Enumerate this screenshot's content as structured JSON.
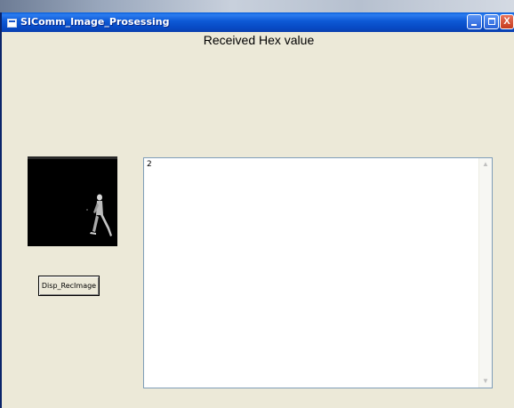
{
  "window": {
    "title": "SIComm_Image_Prosessing",
    "buttons": {
      "minimize": "minimize",
      "maximize": "maximize",
      "close": "X"
    }
  },
  "main": {
    "heading": "Received Hex value",
    "display_button_label": "Disp_RecImage",
    "textarea_value": "2"
  },
  "icons": {
    "app": "app-window-icon",
    "scroll_up": "chevron-up-icon",
    "scroll_down": "chevron-down-icon"
  },
  "colors": {
    "titlebar": "#0a5fd8",
    "window_bg": "#ece9d8",
    "close_button": "#c53a1d"
  }
}
